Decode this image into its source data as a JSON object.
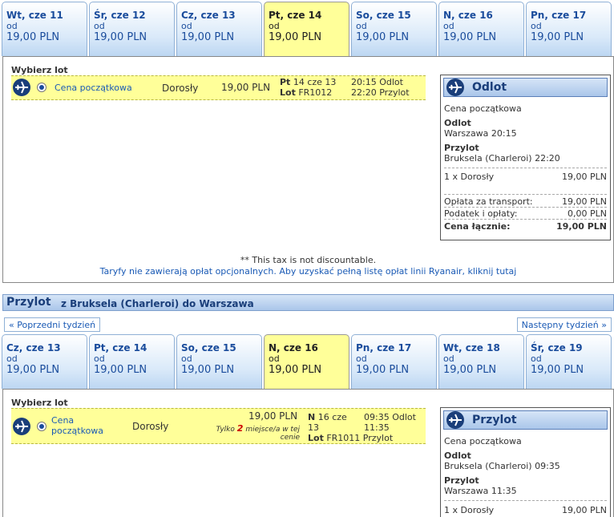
{
  "outbound": {
    "tabs": [
      {
        "day": "Wt, cze 11",
        "od": "od",
        "price": "19,00 PLN",
        "selected": false
      },
      {
        "day": "Śr, cze 12",
        "od": "od",
        "price": "19,00 PLN",
        "selected": false
      },
      {
        "day": "Cz, cze 13",
        "od": "od",
        "price": "19,00 PLN",
        "selected": false
      },
      {
        "day": "Pt, cze 14",
        "od": "od",
        "price": "19,00 PLN",
        "selected": true
      },
      {
        "day": "So, cze 15",
        "od": "od",
        "price": "19,00 PLN",
        "selected": false
      },
      {
        "day": "N, cze 16",
        "od": "od",
        "price": "19,00 PLN",
        "selected": false
      },
      {
        "day": "Pn, cze 17",
        "od": "od",
        "price": "19,00 PLN",
        "selected": false
      }
    ],
    "choose_label": "Wybierz lot",
    "flight": {
      "fare": "Cena początkowa",
      "passenger": "Dorosły",
      "price": "19,00 PLN",
      "day_short": "Pt",
      "date": "14 cze 13",
      "lot_label": "Lot",
      "flight_no": "FR1012",
      "dep_time": "20:15",
      "dep_label": "Odlot",
      "arr_time": "22:20",
      "arr_label": "Przylot"
    },
    "summary": {
      "title": "Odlot",
      "fare": "Cena początkowa",
      "dep_label": "Odlot",
      "dep_value": "Warszawa 20:15",
      "arr_label": "Przylot",
      "arr_value": "Bruksela (Charleroi) 22:20",
      "pax_label": "1 x Dorosły",
      "pax_price": "19,00 PLN",
      "transport_label": "Opłata za transport:",
      "transport_value": "19,00 PLN",
      "tax_label": "Podatek i opłaty:",
      "tax_value": "0,00 PLN",
      "total_label": "Cena łącznie:",
      "total_value": "19,00 PLN"
    },
    "note_tax": "** This tax is not discountable.",
    "note_fares": "Taryfy nie zawierają opłat opcjonalnych. Aby uzyskać pełną listę opłat linii Ryanair, kliknij tutaj"
  },
  "return": {
    "section_title": "Przylot",
    "section_route": "z Bruksela (Charleroi) do Warszawa",
    "prev_week": "« Poprzedni tydzień",
    "next_week": "Następny tydzień »",
    "tabs": [
      {
        "day": "Cz, cze 13",
        "od": "od",
        "price": "19,00 PLN",
        "selected": false
      },
      {
        "day": "Pt, cze 14",
        "od": "od",
        "price": "19,00 PLN",
        "selected": false
      },
      {
        "day": "So, cze 15",
        "od": "od",
        "price": "19,00 PLN",
        "selected": false
      },
      {
        "day": "N, cze 16",
        "od": "od",
        "price": "19,00 PLN",
        "selected": true
      },
      {
        "day": "Pn, cze 17",
        "od": "od",
        "price": "19,00 PLN",
        "selected": false
      },
      {
        "day": "Wt, cze 18",
        "od": "od",
        "price": "19,00 PLN",
        "selected": false
      },
      {
        "day": "Śr, cze 19",
        "od": "od",
        "price": "19,00 PLN",
        "selected": false
      }
    ],
    "choose_label": "Wybierz lot",
    "flight": {
      "fare_line1": "Cena",
      "fare_line2": "początkowa",
      "passenger": "Dorosły",
      "price": "19,00 PLN",
      "seats_pre": "Tylko",
      "seats_num": "2",
      "seats_post": "miejsce/a w tej",
      "seats_post2": "cenie",
      "day_short": "N",
      "date_line1": "16 cze",
      "date_line2": "13",
      "lot_label": "Lot",
      "flight_no": "FR1011",
      "dep_time": "09:35",
      "dep_label": "Odlot",
      "arr_time": "11:35",
      "arr_label": "Przylot"
    },
    "summary": {
      "title": "Przylot",
      "fare": "Cena początkowa",
      "dep_label": "Odlot",
      "dep_value": "Bruksela (Charleroi) 09:35",
      "arr_label": "Przylot",
      "arr_value": "Warszawa 11:35",
      "pax_label": "1 x Dorosły",
      "pax_price": "19,00 PLN"
    }
  },
  "colors": {
    "selected_tab": "#ffff99",
    "link": "#1a5ab5",
    "highlight": "#cc0000"
  }
}
